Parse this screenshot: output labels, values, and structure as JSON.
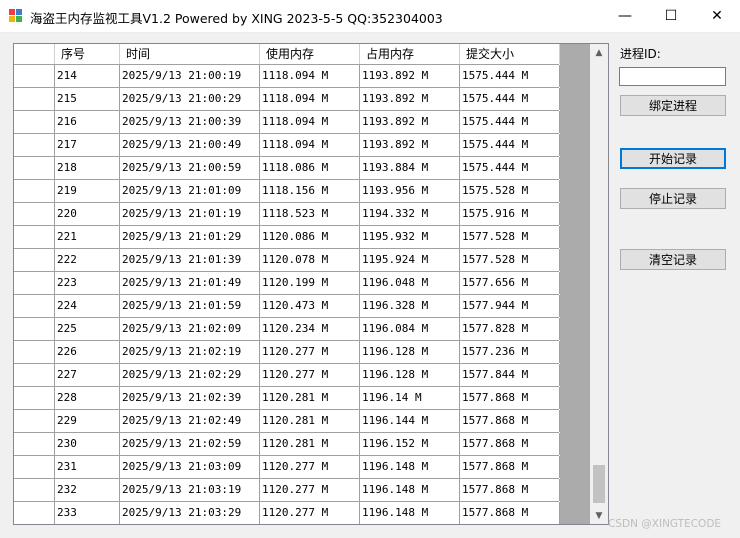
{
  "window": {
    "title": "海盗王内存监视工具V1.2 Powered by XING 2023-5-5 QQ:352304003",
    "minimize_glyph": "—",
    "maximize_glyph": "☐",
    "close_glyph": "✕"
  },
  "grid": {
    "columns": [
      "",
      "序号",
      "时间",
      "使用内存",
      "占用内存",
      "提交大小"
    ],
    "rows": [
      [
        "214",
        "2025/9/13 21:00:19",
        "1118.094 M",
        "1193.892 M",
        "1575.444 M"
      ],
      [
        "215",
        "2025/9/13 21:00:29",
        "1118.094 M",
        "1193.892 M",
        "1575.444 M"
      ],
      [
        "216",
        "2025/9/13 21:00:39",
        "1118.094 M",
        "1193.892 M",
        "1575.444 M"
      ],
      [
        "217",
        "2025/9/13 21:00:49",
        "1118.094 M",
        "1193.892 M",
        "1575.444 M"
      ],
      [
        "218",
        "2025/9/13 21:00:59",
        "1118.086 M",
        "1193.884 M",
        "1575.444 M"
      ],
      [
        "219",
        "2025/9/13 21:01:09",
        "1118.156 M",
        "1193.956 M",
        "1575.528 M"
      ],
      [
        "220",
        "2025/9/13 21:01:19",
        "1118.523 M",
        "1194.332 M",
        "1575.916 M"
      ],
      [
        "221",
        "2025/9/13 21:01:29",
        "1120.086 M",
        "1195.932 M",
        "1577.528 M"
      ],
      [
        "222",
        "2025/9/13 21:01:39",
        "1120.078 M",
        "1195.924 M",
        "1577.528 M"
      ],
      [
        "223",
        "2025/9/13 21:01:49",
        "1120.199 M",
        "1196.048 M",
        "1577.656 M"
      ],
      [
        "224",
        "2025/9/13 21:01:59",
        "1120.473 M",
        "1196.328 M",
        "1577.944 M"
      ],
      [
        "225",
        "2025/9/13 21:02:09",
        "1120.234 M",
        "1196.084 M",
        "1577.828 M"
      ],
      [
        "226",
        "2025/9/13 21:02:19",
        "1120.277 M",
        "1196.128 M",
        "1577.236 M"
      ],
      [
        "227",
        "2025/9/13 21:02:29",
        "1120.277 M",
        "1196.128 M",
        "1577.844 M"
      ],
      [
        "228",
        "2025/9/13 21:02:39",
        "1120.281 M",
        "1196.14 M",
        "1577.868 M"
      ],
      [
        "229",
        "2025/9/13 21:02:49",
        "1120.281 M",
        "1196.144 M",
        "1577.868 M"
      ],
      [
        "230",
        "2025/9/13 21:02:59",
        "1120.281 M",
        "1196.152 M",
        "1577.868 M"
      ],
      [
        "231",
        "2025/9/13 21:03:09",
        "1120.277 M",
        "1196.148 M",
        "1577.868 M"
      ],
      [
        "232",
        "2025/9/13 21:03:19",
        "1120.277 M",
        "1196.148 M",
        "1577.868 M"
      ],
      [
        "233",
        "2025/9/13 21:03:29",
        "1120.277 M",
        "1196.148 M",
        "1577.868 M"
      ]
    ]
  },
  "panel": {
    "process_id_label": "进程ID:",
    "process_id_value": "",
    "bind_button": "绑定进程",
    "start_button": "开始记录",
    "stop_button": "停止记录",
    "clear_button": "清空记录"
  },
  "watermark": "CSDN @XINGTECODE"
}
